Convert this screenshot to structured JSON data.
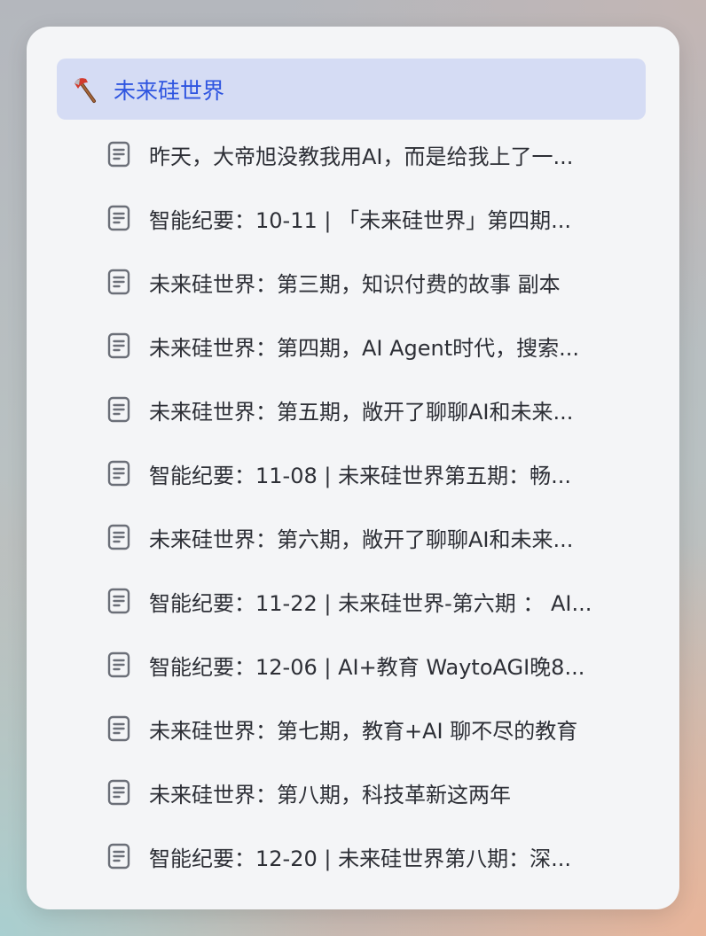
{
  "folder": {
    "icon": "axe-icon",
    "title": "未来硅世界"
  },
  "documents": [
    {
      "icon": "document-icon",
      "label": "昨天，大帝旭没教我用AI，而是给我上了一..."
    },
    {
      "icon": "document-icon",
      "label": "智能纪要：10-11 | 「未来硅世界」第四期..."
    },
    {
      "icon": "document-icon",
      "label": "未来硅世界：第三期，知识付费的故事 副本"
    },
    {
      "icon": "document-icon",
      "label": "未来硅世界：第四期，AI Agent时代，搜索..."
    },
    {
      "icon": "document-icon",
      "label": "未来硅世界：第五期，敞开了聊聊AI和未来..."
    },
    {
      "icon": "document-icon",
      "label": "智能纪要：11-08 | 未来硅世界第五期：畅..."
    },
    {
      "icon": "document-icon",
      "label": "未来硅世界：第六期，敞开了聊聊AI和未来..."
    },
    {
      "icon": "document-icon",
      "label": "智能纪要：11-22 | 未来硅世界-第六期 ： AI..."
    },
    {
      "icon": "document-icon",
      "label": "智能纪要：12-06 | AI+教育 WaytoAGI晚8..."
    },
    {
      "icon": "document-icon",
      "label": "未来硅世界：第七期，教育+AI 聊不尽的教育"
    },
    {
      "icon": "document-icon",
      "label": "未来硅世界：第八期，科技革新这两年"
    },
    {
      "icon": "document-icon",
      "label": "智能纪要：12-20 | 未来硅世界第八期：深..."
    }
  ],
  "colors": {
    "selected_background": "#d5dcf4",
    "selected_text": "#2f55e0",
    "item_text": "#2d2f36",
    "icon_stroke": "#6b6f78"
  }
}
